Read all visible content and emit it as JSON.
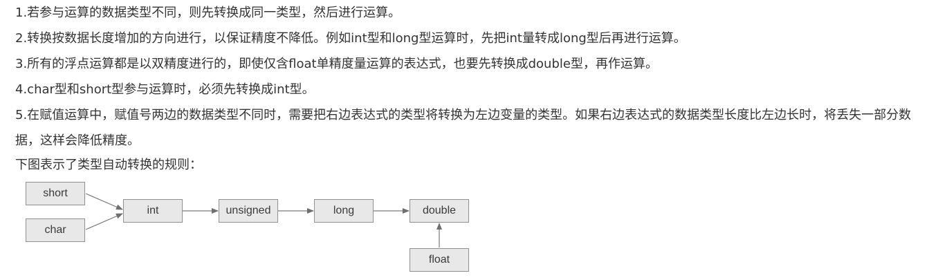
{
  "paragraphs": {
    "p1": "1.若参与运算的数据类型不同，则先转换成同一类型，然后进行运算。",
    "p2": "2.转换按数据长度增加的方向进行，以保证精度不降低。例如int型和long型运算时，先把int量转成long型后再进行运算。",
    "p3": "3.所有的浮点运算都是以双精度进行的，即使仅含float单精度量运算的表达式，也要先转换成double型，再作运算。",
    "p4": "4.char型和short型参与运算时，必须先转换成int型。",
    "p5": "5.在赋值运算中，赋值号两边的数据类型不同时，需要把右边表达式的类型将转换为左边变量的类型。如果右边表达式的数据类型长度比左边长时，将丢失一部分数据，这样会降低精度。",
    "intro": "下图表示了类型自动转换的规则："
  },
  "diagram": {
    "short": "short",
    "char": "char",
    "int": "int",
    "unsigned": "unsigned",
    "long": "long",
    "double": "double",
    "float": "float"
  },
  "colors": {
    "text": "#333333",
    "box_fill": "#e8e8e8",
    "box_border": "#8f8f8f",
    "arrow": "#7a7a7a"
  }
}
